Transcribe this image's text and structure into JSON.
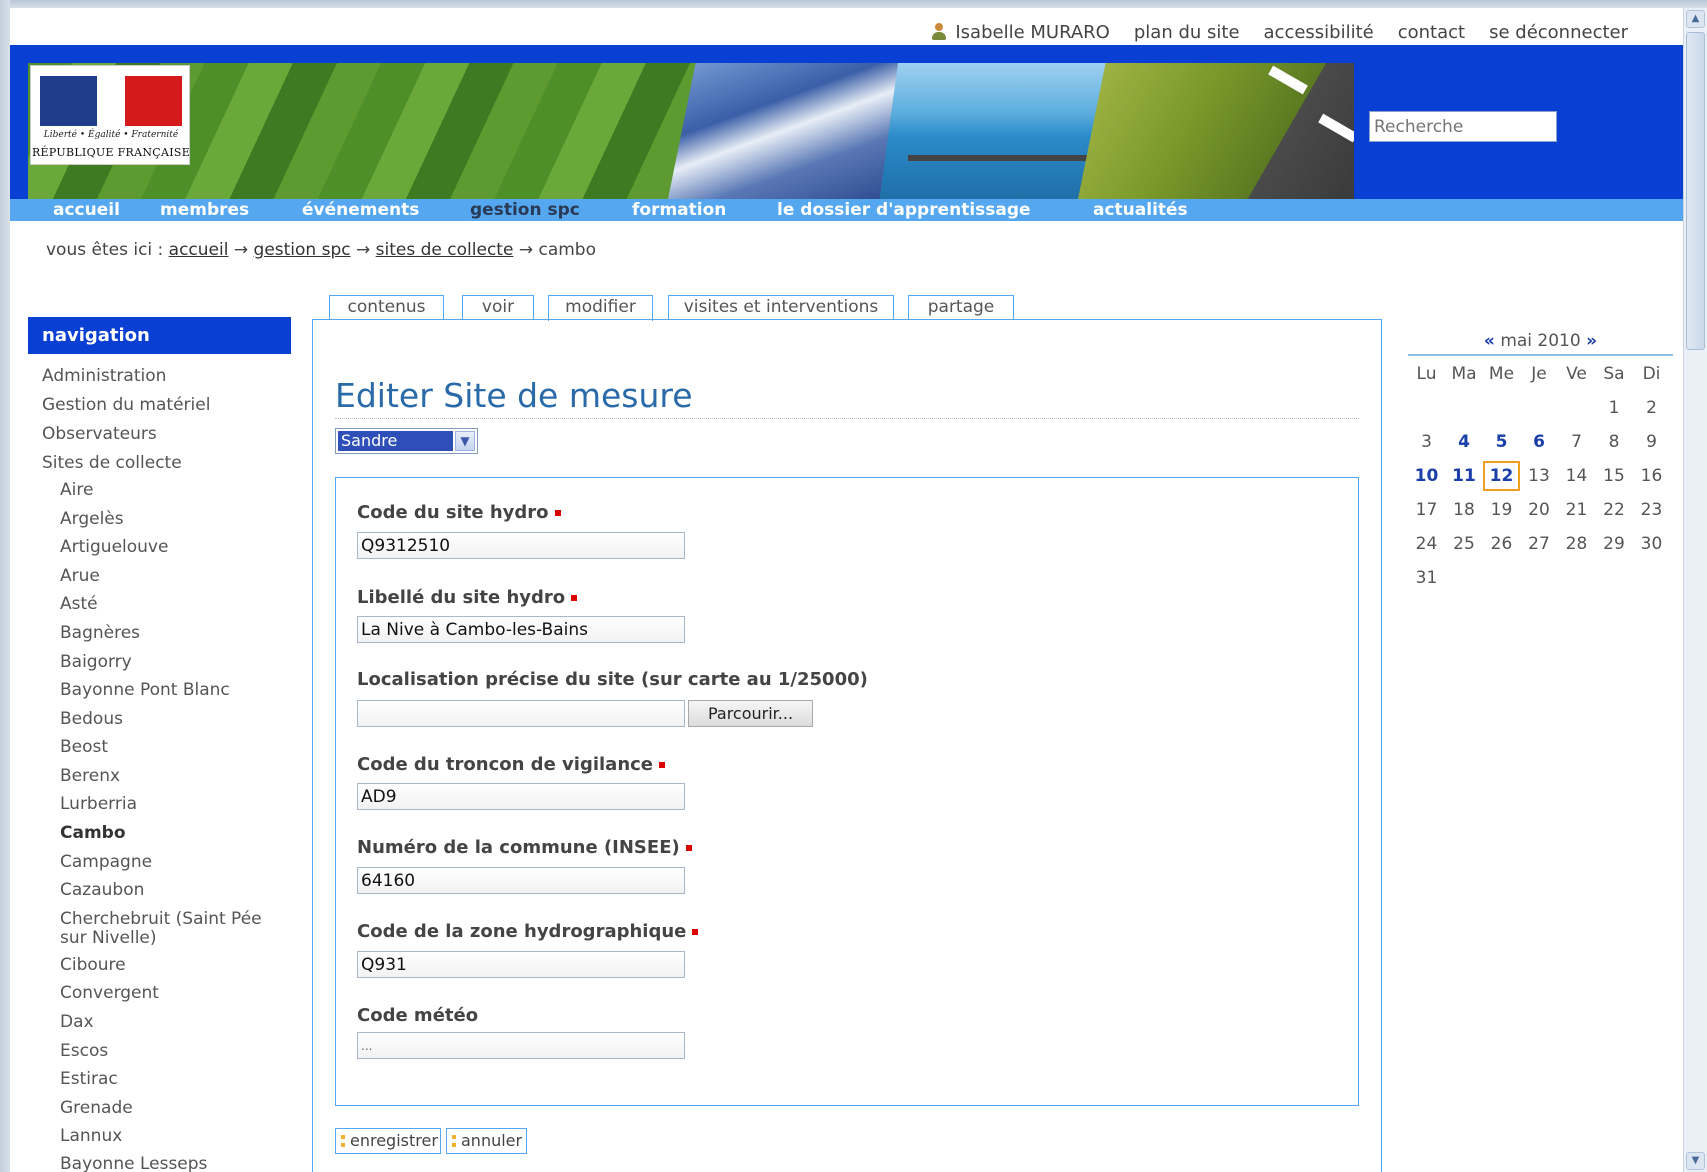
{
  "toplinks": {
    "user": "Isabelle MURARO",
    "sitemap": "plan du site",
    "accessibility": "accessibilité",
    "contact": "contact",
    "logout": "se déconnecter"
  },
  "logo": {
    "motto": "Liberté • Égalité • Fraternité",
    "name": "RÉPUBLIQUE FRANÇAISE"
  },
  "search": {
    "placeholder": "Recherche"
  },
  "nav": {
    "items": [
      "accueil",
      "membres",
      "événements",
      "gestion spc",
      "formation",
      "le dossier d'apprentissage",
      "actualités"
    ],
    "active": "gestion spc"
  },
  "breadcrumb": {
    "prefix": "vous êtes ici :",
    "links": [
      "accueil",
      "gestion spc",
      "sites de collecte"
    ],
    "separator": "→",
    "current": "cambo"
  },
  "tabs": [
    "contenus",
    "voir",
    "modifier",
    "visites et interventions",
    "partage"
  ],
  "sidebar": {
    "title": "navigation",
    "top_items": [
      "Administration",
      "Gestion du matériel",
      "Observateurs",
      "Sites de collecte"
    ],
    "sub_items": [
      "Aire",
      "Argelès",
      "Artiguelouve",
      "Arue",
      "Asté",
      "Bagnères",
      "Baigorry",
      "Bayonne Pont Blanc",
      "Bedous",
      "Beost",
      "Berenx",
      "Lurberria",
      "Cambo",
      "Campagne",
      "Cazaubon",
      "Cherchebruit (Saint Pée",
      "sur Nivelle)",
      "Ciboure",
      "Convergent",
      "Dax",
      "Escos",
      "Estirac",
      "Grenade",
      "Lannux",
      "Bayonne Lesseps"
    ]
  },
  "form": {
    "title": "Editer Site de mesure",
    "schema_select": "Sandre",
    "fields": {
      "code_site": {
        "label": "Code du site hydro",
        "value": "Q9312510"
      },
      "libelle_site": {
        "label": "Libellé du site hydro",
        "value": "La Nive à Cambo-les-Bains"
      },
      "localisation": {
        "label": "Localisation précise du site (sur carte au 1/25000)",
        "value": "",
        "browse": "Parcourir..."
      },
      "troncon": {
        "label": "Code du troncon de vigilance",
        "value": "AD9"
      },
      "commune": {
        "label": "Numéro de la commune (INSEE)",
        "value": "64160"
      },
      "zone": {
        "label": "Code de la zone hydrographique",
        "value": "Q931"
      },
      "meteo": {
        "label": "Code météo",
        "value": "..."
      }
    },
    "save": "enregistrer",
    "cancel": "annuler"
  },
  "calendar": {
    "prev": "«",
    "month": "mai 2010",
    "next": "»",
    "weekdays": [
      "Lu",
      "Ma",
      "Me",
      "Je",
      "Ve",
      "Sa",
      "Di"
    ],
    "weeks": [
      [
        "",
        "",
        "",
        "",
        "",
        "1",
        "2"
      ],
      [
        "3",
        "4",
        "5",
        "6",
        "7",
        "8",
        "9"
      ],
      [
        "10",
        "11",
        "12",
        "13",
        "14",
        "15",
        "16"
      ],
      [
        "17",
        "18",
        "19",
        "20",
        "21",
        "22",
        "23"
      ],
      [
        "24",
        "25",
        "26",
        "27",
        "28",
        "29",
        "30"
      ],
      [
        "31",
        "",
        "",
        "",
        "",
        "",
        ""
      ]
    ],
    "event_days": [
      "4",
      "5",
      "6",
      "10",
      "11",
      "12"
    ],
    "today": "12"
  }
}
